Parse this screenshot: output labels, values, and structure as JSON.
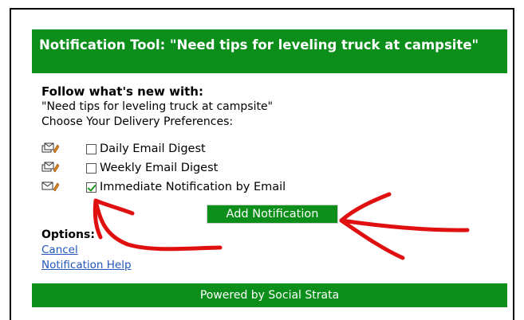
{
  "header": {
    "title": "Notification Tool: \"Need tips for leveling truck at campsite\""
  },
  "main": {
    "follow_label": "Follow what's new with:",
    "topic": "\"Need tips for leveling truck at campsite\"",
    "choose_label": "Choose Your Delivery Preferences:",
    "options": [
      {
        "label": "Daily Email Digest",
        "checked": false,
        "icon": "digest-envelope-icon"
      },
      {
        "label": "Weekly Email Digest",
        "checked": false,
        "icon": "digest-envelope-icon"
      },
      {
        "label": "Immediate Notification by Email",
        "checked": true,
        "icon": "envelope-pencil-icon"
      }
    ],
    "add_button_label": "Add Notification",
    "options_heading": "Options:",
    "links": {
      "cancel": "Cancel",
      "help": "Notification Help"
    }
  },
  "footer": {
    "text": "Powered by Social Strata"
  },
  "colors": {
    "brand_green": "#0b8f1a",
    "link_blue": "#2255bb",
    "annotation_red": "#e01010"
  }
}
